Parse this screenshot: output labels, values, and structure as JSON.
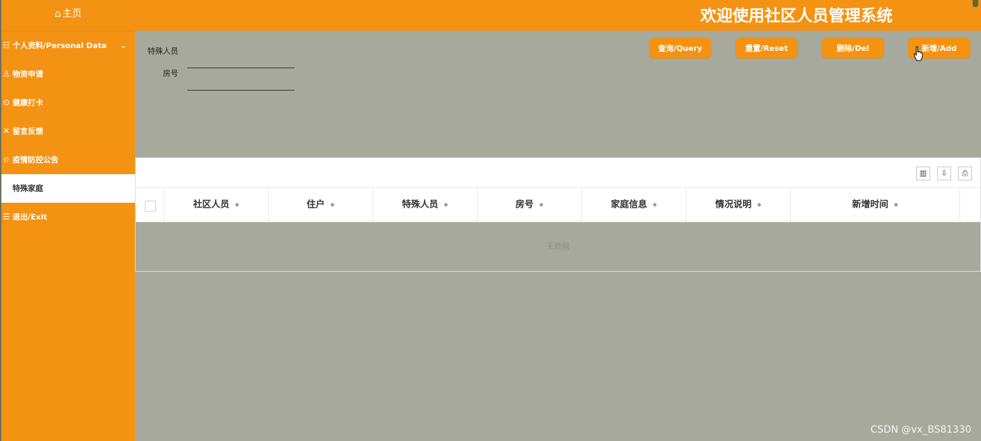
{
  "sidebar": {
    "home_label": "主页",
    "items": [
      {
        "label": "个人资料/Personal Data",
        "icon": "user-card-icon",
        "chevron": "⌄"
      },
      {
        "label": "物资申请",
        "icon": "user-icon"
      },
      {
        "label": "健康打卡",
        "icon": "clock-icon"
      },
      {
        "label": "留言反馈",
        "icon": "tools-icon"
      },
      {
        "label": "疫情防控公告",
        "icon": "bell-icon"
      },
      {
        "label": "特殊家庭",
        "icon": "",
        "active": true
      },
      {
        "label": "退出/Exit",
        "icon": "exit-icon"
      }
    ]
  },
  "header": {
    "title": "欢迎使用社区人员管理系统"
  },
  "search": {
    "field1_label": "特殊人员",
    "field2_label": "房号"
  },
  "buttons": {
    "query": "查询/Query",
    "reset": "重置/Reset",
    "delete": "删除/Del",
    "add": "新增/Add"
  },
  "table": {
    "columns": [
      "社区人员",
      "住户",
      "特殊人员",
      "房号",
      "家庭信息",
      "情况说明",
      "新增时间"
    ],
    "empty_text": "无数据"
  },
  "watermark": "CSDN @vx_BS81330",
  "colors": {
    "accent": "#f39213",
    "background": "#a6a99b"
  }
}
